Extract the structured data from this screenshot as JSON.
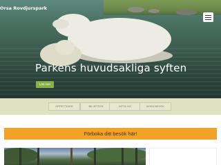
{
  "site": {
    "logo_text": "Orsa Rovdjurspark"
  },
  "hero": {
    "title": "Parkens huvudsakliga syften",
    "cta_label": "Läs mer"
  },
  "tabs": [
    {
      "label": "ÖPPETTIDER"
    },
    {
      "label": "BILJETTER"
    },
    {
      "label": "HITTA HIT"
    },
    {
      "label": "BOKA BESÖK"
    }
  ],
  "banner": {
    "text": "Förboka ditt besök här!"
  },
  "colors": {
    "accent_orange": "#f3a228",
    "accent_green": "#8ab04a",
    "tabbar_bg": "#dfe2c2"
  },
  "icons": {
    "menu": "hamburger-menu-icon"
  }
}
